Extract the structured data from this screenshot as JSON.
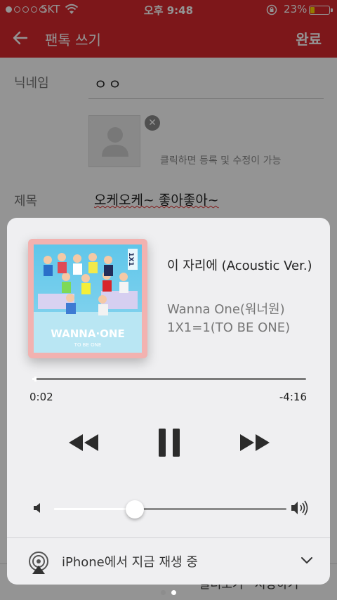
{
  "status_bar": {
    "carrier": "SKT",
    "time": "오후 9:48",
    "battery_percent": "23%",
    "battery_level": 0.23,
    "signal_bars": 1
  },
  "app_bar": {
    "title": "팬톡 쓰기",
    "done_label": "완료"
  },
  "form": {
    "nickname_label": "닉네임",
    "nickname_value": "ㅇㅇ",
    "photo_hint": "클릭하면 등록 및 수정이 가능",
    "title_label": "제목",
    "title_value": "오케오케~ 좋아좋아~",
    "bottom_text": "불러오기 · 저장하기"
  },
  "now_playing": {
    "song_title": "이 자리에 (Acoustic Ver.)",
    "artist": "Wanna One(워너원)",
    "album": "1X1=1(TO BE ONE)",
    "artwork_text": "WANNA·ONE",
    "artwork_subtext": "TO BE ONE",
    "artwork_side": "1X1",
    "elapsed": "0:02",
    "remaining": "-4:16",
    "progress": 0.008,
    "volume": 0.35,
    "airplay_label": "iPhone에서 지금 재생 중"
  },
  "page_indicator": {
    "count": 2,
    "active": 1
  },
  "colors": {
    "brand_red": "#d8292e",
    "card_bg": "#efeff1",
    "artwork_frame": "#f2b2b0"
  }
}
